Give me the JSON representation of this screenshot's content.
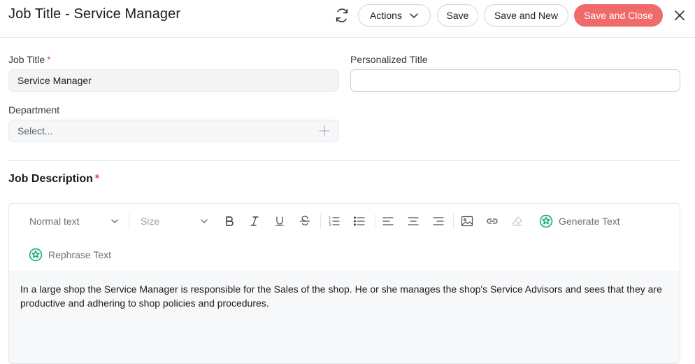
{
  "header": {
    "title": "Job Title - Service Manager",
    "actions_label": "Actions",
    "save_label": "Save",
    "save_new_label": "Save and New",
    "save_close_label": "Save and Close"
  },
  "form": {
    "job_title": {
      "label": "Job Title",
      "required_mark": "*",
      "value": "Service Manager"
    },
    "personalized_title": {
      "label": "Personalized Title",
      "value": ""
    },
    "department": {
      "label": "Department",
      "placeholder": "Select..."
    }
  },
  "job_description": {
    "title": "Job Description",
    "required_mark": "*",
    "toolbar": {
      "text_style": "Normal text",
      "size": "Size",
      "generate_label": "Generate Text",
      "rephrase_label": "Rephrase Text"
    },
    "body": "In a large shop the Service Manager is responsible for the Sales of the shop. He or she manages the shop's Service Advisors and sees that they are productive and adhering to shop policies and procedures."
  },
  "colors": {
    "accent": "#ef6a6a",
    "required": "#e24a4a",
    "ai_icon": "#10a37f"
  }
}
